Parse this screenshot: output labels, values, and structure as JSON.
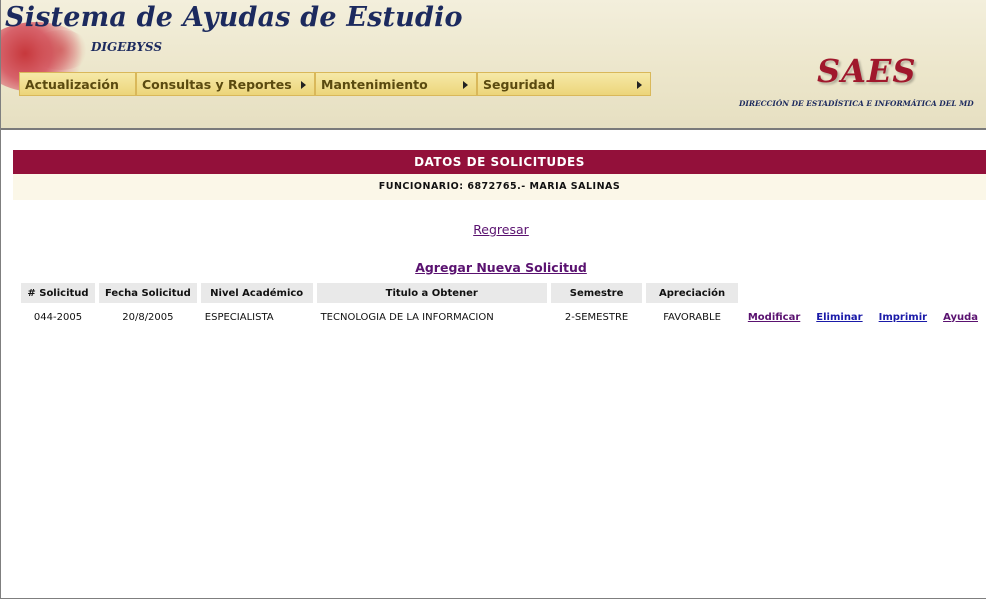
{
  "header": {
    "app_title": "Sistema de Ayudas de Estudio",
    "app_subtitle": "DIGEBYSS",
    "brand": "SAES",
    "department": "DIRECCIÓN DE ESTADÍSTICA E INFORMÁTICA DEL MD"
  },
  "menu": [
    {
      "label": "Actualización",
      "has_submenu": false
    },
    {
      "label": "Consultas y Reportes",
      "has_submenu": true
    },
    {
      "label": "Mantenimiento",
      "has_submenu": true
    },
    {
      "label": "Seguridad",
      "has_submenu": true
    }
  ],
  "page": {
    "section_title": "DATOS DE SOLICITUDES",
    "official": "FUNCIONARIO: 6872765.- MARIA SALINAS",
    "back_link": "Regresar",
    "add_link": "Agregar Nueva Solicitud"
  },
  "table": {
    "headers": [
      "# Solicitud",
      "Fecha Solicitud",
      "Nivel Académico",
      "Titulo a Obtener",
      "Semestre",
      "Apreciación"
    ],
    "rows": [
      {
        "solicitud": "044-2005",
        "fecha": "20/8/2005",
        "nivel": "ESPECIALISTA",
        "titulo": "TECNOLOGIA DE LA INFORMACION",
        "semestre": "2-SEMESTRE",
        "apreciacion": "FAVORABLE",
        "actions": {
          "modify": "Modificar",
          "delete": "Eliminar",
          "print": "Imprimir",
          "help": "Ayuda"
        }
      }
    ]
  },
  "colors": {
    "title_bar": "#93103a",
    "menu_bg": "#ecd57a",
    "header_text": "#1c2a5e",
    "brand": "#a0182c"
  }
}
